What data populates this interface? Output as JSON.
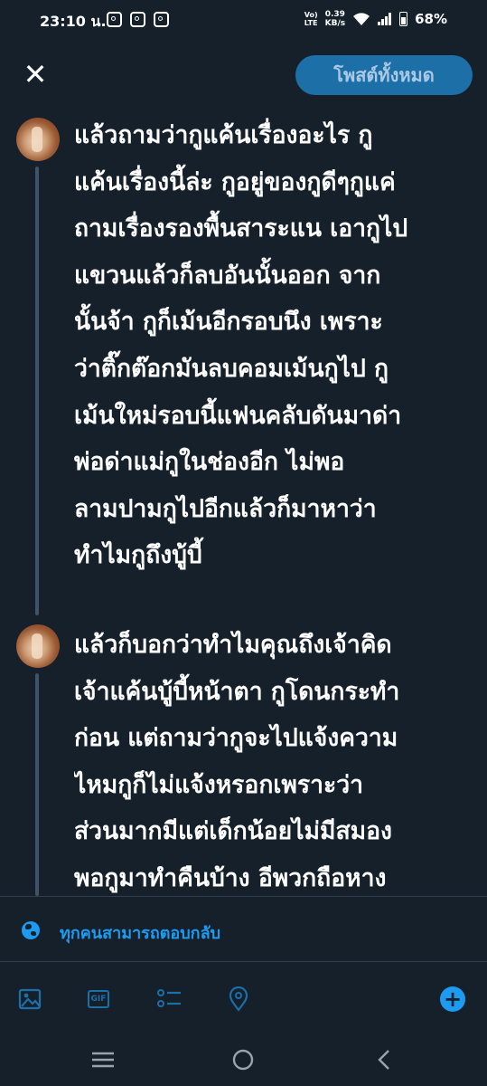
{
  "status_bar": {
    "time": "23:10 น.",
    "volte_top": "Vo)",
    "volte_bottom": "LTE",
    "speed_value": "0.39",
    "speed_unit": "KB/s",
    "battery": "68%"
  },
  "header": {
    "close_icon": "close-icon",
    "post_all_label": "โพสต์ทั้งหมด"
  },
  "thread": {
    "tweets": [
      {
        "text": "แล้วถามว่ากูแค้นเรื่องอะไร กู\nแค้นเรื่องนี้ล่ะ กูอยู่ของกูดีๆกูแค่\nถามเรื่องรองพื้นสาระแน เอากูไป\nแขวนแล้วก็ลบอันนั้นออก จาก\nนั้นจ้า  กูก็เม้นอีกรอบนึง เพราะ\nว่าติ๊กต๊อกมันลบคอมเม้นกูไป กู\nเม้นใหม่รอบนี้แฟนคลับดันมาด่า\nพ่อด่าแม่กูในช่องอีก ไม่พอ\nลามปามกูไปอีกแล้วก็มาหาว่า\nทำไมกูถึงบู้บี้"
      },
      {
        "text": "แล้วก็บอกว่าทำไมคุณถึงเจ้าคิด\nเจ้าแค้นบู้บี้หน้าตา กูโดนกระทำ\nก่อน แต่ถามว่ากูจะไปแจ้งความ\nไหมกูก็ไม่แจ้งหรอกเพราะว่า\nส่วนมากมีแต่เด็กน้อยไม่มีสมอง\nพอกูมาทำคืนบ้าง อีพวกถือหาง"
      }
    ]
  },
  "reply_setting": {
    "label": "ทุกคนสามารถตอบกลับ"
  },
  "toolbar": {
    "gif_label": "GIF",
    "add_label": "+"
  },
  "colors": {
    "background": "#15202b",
    "accent": "#1d9bf0",
    "button": "#1d6fa8"
  }
}
